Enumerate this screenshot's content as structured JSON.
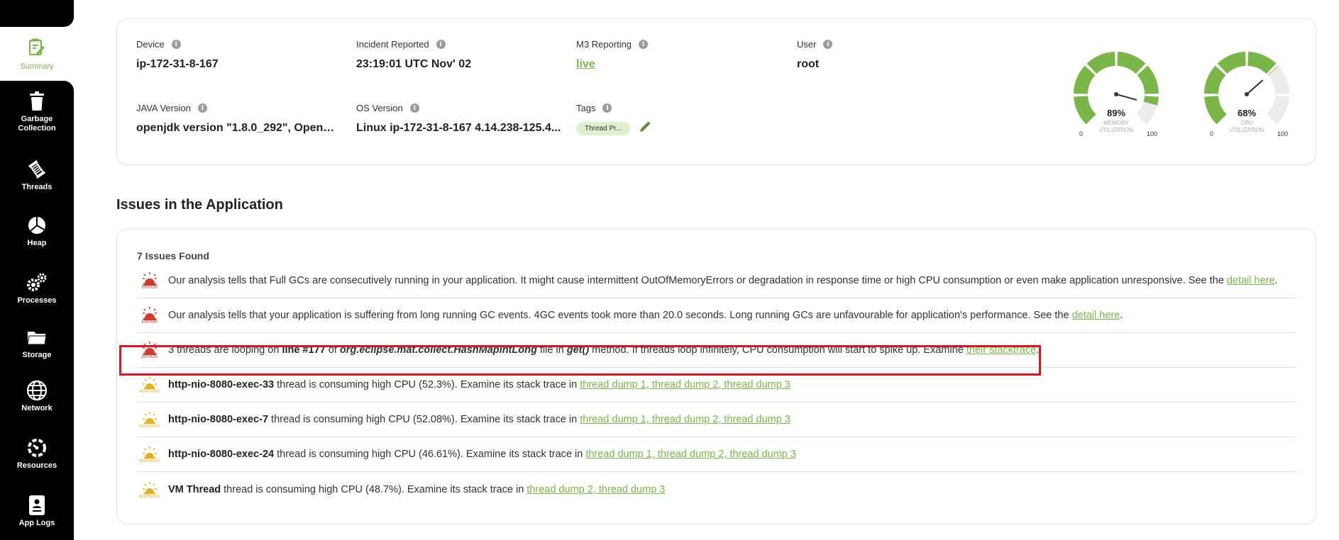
{
  "sidebar": {
    "items": [
      {
        "label": "Summary",
        "icon": "summary-icon",
        "active": true
      },
      {
        "label": "Garbage Collection",
        "icon": "trash-icon"
      },
      {
        "label": "Threads",
        "icon": "threads-icon"
      },
      {
        "label": "Heap",
        "icon": "pie-chart-icon"
      },
      {
        "label": "Processes",
        "icon": "gears-icon"
      },
      {
        "label": "Storage",
        "icon": "folder-icon"
      },
      {
        "label": "Network",
        "icon": "globe-icon"
      },
      {
        "label": "Resources",
        "icon": "resources-icon"
      },
      {
        "label": "App Logs",
        "icon": "app-logs-icon"
      }
    ]
  },
  "summary": {
    "device_label": "Device",
    "device_value": "ip-172-31-8-167",
    "incident_label": "Incident Reported",
    "incident_value": "23:19:01 UTC Nov' 02",
    "m3_label": "M3 Reporting",
    "m3_value": "live",
    "user_label": "User",
    "user_value": "root",
    "java_label": "JAVA Version",
    "java_value": "openjdk version \"1.8.0_292\", OpenJ...",
    "os_label": "OS Version",
    "os_value": "Linux ip-172-31-8-167 4.14.238-125.4...",
    "tags_label": "Tags",
    "tag_value": "Thread Pr..."
  },
  "gauges": [
    {
      "percent": "89%",
      "value": 89,
      "min": "0",
      "max": "100",
      "caption_line1": "MEMORY",
      "caption_line2": "UTILIZATION"
    },
    {
      "percent": "68%",
      "value": 68,
      "min": "0",
      "max": "100",
      "caption_line1": "CPU",
      "caption_line2": "UTILIZATION"
    }
  ],
  "colors": {
    "accent": "#7ab648",
    "error": "#d43a2f",
    "warning": "#e3b21e",
    "highlight": "#e0141e"
  },
  "issues": {
    "title": "Issues in the Application",
    "found": "7 Issues Found",
    "rows": [
      {
        "severity": "ERROR",
        "parts": [
          {
            "t": "Our analysis tells that Full GCs are consecutively running in your application. It might cause intermittent OutOfMemoryErrors or degradation in response time or high CPU consumption or even make application unresponsive. See the "
          },
          {
            "t": "detail here",
            "link": true
          },
          {
            "t": "."
          }
        ]
      },
      {
        "severity": "ERROR",
        "parts": [
          {
            "t": "Our analysis tells that your application is suffering from long running GC events. 4GC events took more than 20.0 seconds. Long running GCs are unfavourable for application's performance. See the "
          },
          {
            "t": "detail here",
            "link": true
          },
          {
            "t": "."
          }
        ]
      },
      {
        "severity": "ERROR",
        "highlight": true,
        "parts": [
          {
            "t": "3 threads are looping on "
          },
          {
            "t": "line #177",
            "bold": true
          },
          {
            "t": " of "
          },
          {
            "t": "org.eclipse.mat.collect.HashMapIntLong",
            "bold": true,
            "italic": true
          },
          {
            "t": " file in "
          },
          {
            "t": "get()",
            "bold": true,
            "italic": true
          },
          {
            "t": " method. If threads loop infinitely, CPU consumption will start to spike up. Examine "
          },
          {
            "t": "their stacktrace",
            "link": true
          },
          {
            "t": "."
          }
        ]
      },
      {
        "severity": "WARNING",
        "parts": [
          {
            "t": "http-nio-8080-exec-33",
            "bold": true
          },
          {
            "t": " thread is consuming high CPU (52.3%). Examine its stack trace in "
          },
          {
            "t": "thread dump 1, thread dump 2, thread dump 3",
            "link": true
          }
        ]
      },
      {
        "severity": "WARNING",
        "parts": [
          {
            "t": "http-nio-8080-exec-7",
            "bold": true
          },
          {
            "t": " thread is consuming high CPU (52.08%). Examine its stack trace in "
          },
          {
            "t": "thread dump 1, thread dump 2, thread dump 3",
            "link": true
          }
        ]
      },
      {
        "severity": "WARNING",
        "parts": [
          {
            "t": "http-nio-8080-exec-24",
            "bold": true
          },
          {
            "t": " thread is consuming high CPU (46.61%). Examine its stack trace in "
          },
          {
            "t": "thread dump 1, thread dump 2, thread dump 3",
            "link": true
          }
        ]
      },
      {
        "severity": "WARNING",
        "parts": [
          {
            "t": "VM Thread",
            "bold": true
          },
          {
            "t": " thread is consuming high CPU (48.7%). Examine its stack trace in "
          },
          {
            "t": "thread dump 2, thread dump 3",
            "link": true
          }
        ]
      }
    ]
  }
}
